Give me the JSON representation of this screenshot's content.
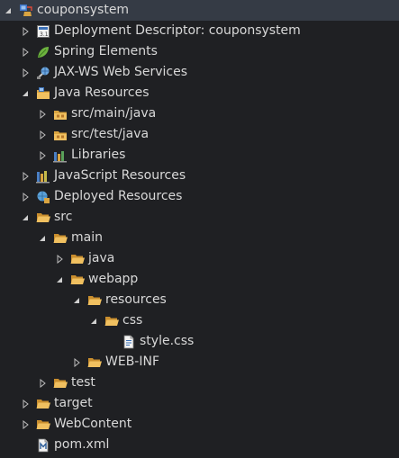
{
  "tree": [
    {
      "label": "couponsystem",
      "toggle": "expanded",
      "icon": "project-icon"
    },
    {
      "label": "Deployment Descriptor: couponsystem",
      "toggle": "collapsed",
      "icon": "deployment-descriptor-icon"
    },
    {
      "label": "Spring Elements",
      "toggle": "collapsed",
      "icon": "spring-leaf-icon"
    },
    {
      "label": "JAX-WS Web Services",
      "toggle": "collapsed",
      "icon": "web-services-icon"
    },
    {
      "label": "Java Resources",
      "toggle": "expanded",
      "icon": "java-resources-icon"
    },
    {
      "label": "src/main/java",
      "toggle": "collapsed",
      "icon": "source-folder-icon"
    },
    {
      "label": "src/test/java",
      "toggle": "collapsed",
      "icon": "source-folder-icon"
    },
    {
      "label": "Libraries",
      "toggle": "collapsed",
      "icon": "libraries-icon"
    },
    {
      "label": "JavaScript Resources",
      "toggle": "collapsed",
      "icon": "javascript-resources-icon"
    },
    {
      "label": "Deployed Resources",
      "toggle": "collapsed",
      "icon": "deployed-resources-icon"
    },
    {
      "label": "src",
      "toggle": "expanded",
      "icon": "folder-icon"
    },
    {
      "label": "main",
      "toggle": "expanded",
      "icon": "folder-icon"
    },
    {
      "label": "java",
      "toggle": "collapsed",
      "icon": "folder-icon"
    },
    {
      "label": "webapp",
      "toggle": "expanded",
      "icon": "folder-icon"
    },
    {
      "label": "resources",
      "toggle": "expanded",
      "icon": "folder-icon"
    },
    {
      "label": "css",
      "toggle": "expanded",
      "icon": "folder-icon"
    },
    {
      "label": "style.css",
      "toggle": "none",
      "icon": "file-icon"
    },
    {
      "label": "WEB-INF",
      "toggle": "collapsed",
      "icon": "folder-icon"
    },
    {
      "label": "test",
      "toggle": "collapsed",
      "icon": "folder-icon"
    },
    {
      "label": "target",
      "toggle": "collapsed",
      "icon": "folder-icon"
    },
    {
      "label": "WebContent",
      "toggle": "collapsed",
      "icon": "folder-icon"
    },
    {
      "label": "pom.xml",
      "toggle": "none",
      "icon": "maven-file-icon"
    }
  ],
  "colors": {
    "background": "#1f2023",
    "selection": "#353b45",
    "text": "#d8d8d8",
    "folder": "#d9a441"
  }
}
